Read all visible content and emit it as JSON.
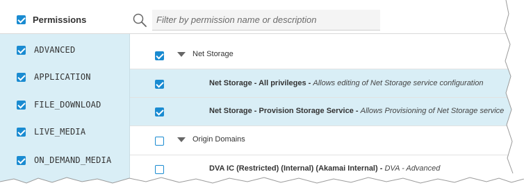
{
  "header": {
    "permissions_label": "Permissions",
    "search_placeholder": "Filter by permission name or description"
  },
  "sidebar": {
    "items": [
      {
        "label": "ADVANCED"
      },
      {
        "label": "APPLICATION"
      },
      {
        "label": "FILE_DOWNLOAD"
      },
      {
        "label": "LIVE_MEDIA"
      },
      {
        "label": "ON_DEMAND_MEDIA"
      }
    ]
  },
  "main": {
    "rows": [
      {
        "type": "group",
        "label": "Net Storage",
        "checked": true
      },
      {
        "type": "permission",
        "name": "Net Storage - All privileges -",
        "description": "Allows editing of Net Storage service configuration",
        "checked": true
      },
      {
        "type": "permission",
        "name": "Net Storage - Provision Storage Service -",
        "description": "Allows Provisioning of Net Storage service",
        "checked": true
      },
      {
        "type": "group",
        "label": "Origin Domains",
        "checked": false
      },
      {
        "type": "permission",
        "name": "DVA IC (Restricted) (Internal) (Akamai Internal) -",
        "description": "DVA - Advanced",
        "checked": false
      }
    ]
  },
  "colors": {
    "accent": "#1a8bd1",
    "selected_bg": "#d9eef6"
  }
}
